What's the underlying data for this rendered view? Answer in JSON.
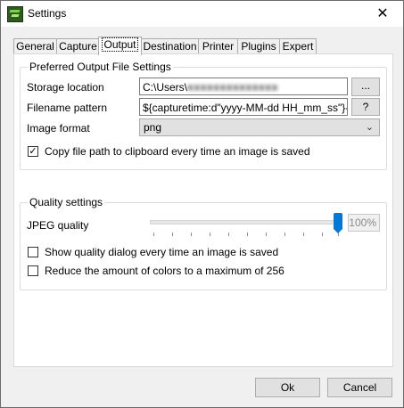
{
  "window": {
    "title": "Settings"
  },
  "tabs": [
    {
      "label": "General"
    },
    {
      "label": "Capture"
    },
    {
      "label": "Output"
    },
    {
      "label": "Destination"
    },
    {
      "label": "Printer"
    },
    {
      "label": "Plugins"
    },
    {
      "label": "Expert"
    }
  ],
  "active_tab": "Output",
  "output": {
    "group_title": "Preferred Output File Settings",
    "storage_label": "Storage location",
    "storage_value": "C:\\Users\\",
    "storage_value_redacted": "■■■■■■■■■■■■■■",
    "browse_label": "...",
    "filename_label": "Filename pattern",
    "filename_value": "${capturetime:d\"yyyy-MM-dd HH_mm_ss\"}-${title}",
    "help_label": "?",
    "format_label": "Image format",
    "format_value": "png",
    "copy_path_label": "Copy file path to clipboard every time an image is saved",
    "copy_path_checked": true
  },
  "quality": {
    "group_title": "Quality settings",
    "jpeg_label": "JPEG quality",
    "jpeg_value": 100,
    "jpeg_display": "100%",
    "show_dialog_label": "Show quality dialog every time an image is saved",
    "show_dialog_checked": false,
    "reduce_colors_label": "Reduce the amount of colors to a maximum of 256",
    "reduce_colors_checked": false
  },
  "buttons": {
    "ok": "Ok",
    "cancel": "Cancel"
  },
  "icons": {
    "app": "greenshot-app-icon",
    "close": "close-icon",
    "dropdown": "chevron-down-icon",
    "check": "checkmark-icon"
  },
  "colors": {
    "accent": "#0078d7",
    "app_icon": "#2d5a1e"
  }
}
